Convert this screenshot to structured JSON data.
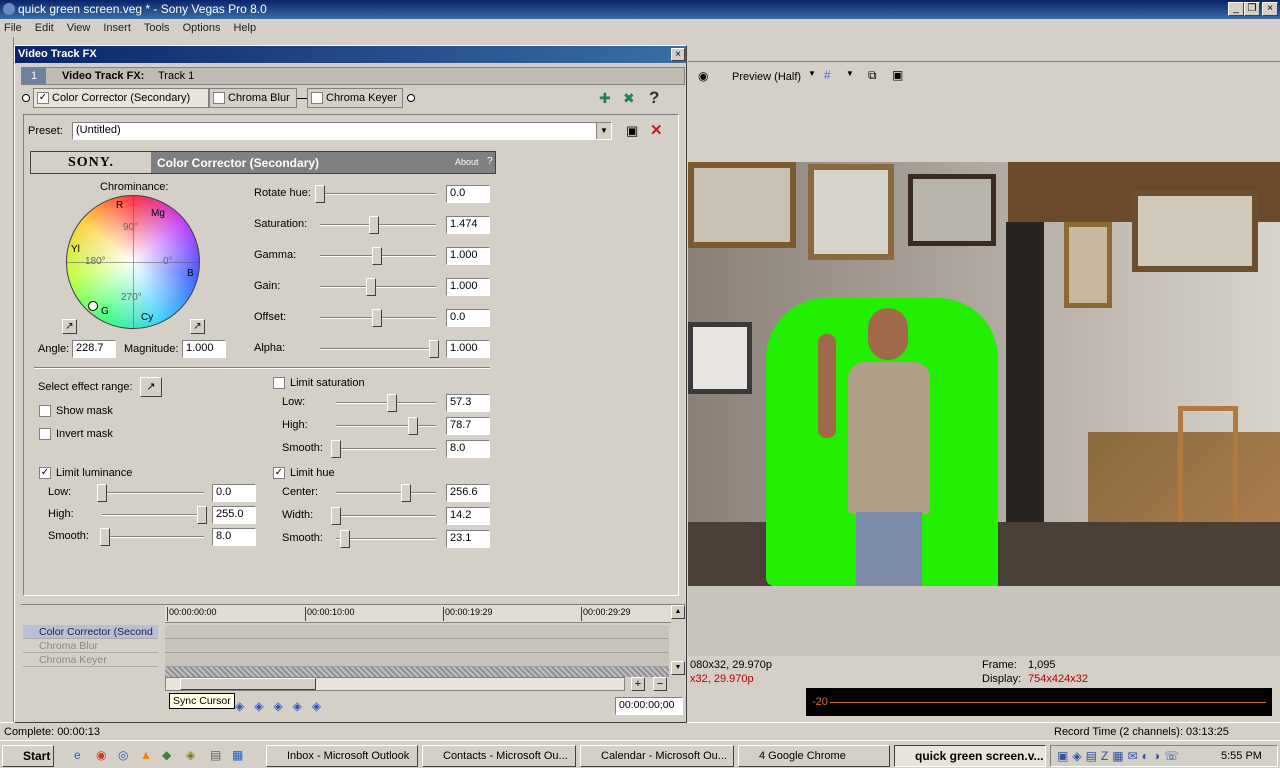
{
  "app": {
    "title": "quick green screen.veg * - Sony Vegas Pro 8.0",
    "menu": [
      "File",
      "Edit",
      "View",
      "Insert",
      "Tools",
      "Options",
      "Help"
    ]
  },
  "preview": {
    "mode": "Preview (Half)"
  },
  "info": {
    "project_line1": "080x32, 29.970p",
    "project_line2": "x32, 29.970p",
    "frame_label": "Frame:",
    "frame_value": "1,095",
    "display_label": "Display:",
    "display_value": "754x424x32",
    "meter_value": "-20"
  },
  "status": {
    "complete": "Complete: 00:00:13",
    "record_time": "Record Time (2 channels): 03:13:25"
  },
  "taskbar": {
    "start": "Start",
    "items": [
      "Inbox - Microsoft Outlook",
      "Contacts - Microsoft Ou...",
      "Calendar - Microsoft Ou...",
      "4 Google Chrome",
      "quick green screen.v..."
    ],
    "clock": "5:55 PM"
  },
  "dialog": {
    "title": "Video Track FX",
    "track_num": "1",
    "track_label": "Video Track FX:",
    "track_name": "Track 1",
    "fx_chain": [
      "Color Corrector (Secondary)",
      "Chroma Blur",
      "Chroma Keyer"
    ],
    "preset_label": "Preset:",
    "preset_value": "(Untitled)",
    "brand": "SONY.",
    "plugin_name": "Color Corrector (Secondary)",
    "about": "About",
    "help": "?",
    "chrominance_label": "Chrominance:",
    "wheel": {
      "r": "R",
      "mg": "Mg",
      "yl": "Yl",
      "b": "B",
      "g": "G",
      "cy": "Cy",
      "d90": "90°",
      "d180": "180°",
      "d0": "0°",
      "d270": "270°"
    },
    "angle_label": "Angle:",
    "angle_value": "228.7",
    "magnitude_label": "Magnitude:",
    "magnitude_value": "1.000",
    "sliders": [
      {
        "label": "Rotate hue:",
        "value": "0.0",
        "pos": 0.0
      },
      {
        "label": "Saturation:",
        "value": "1.474",
        "pos": 0.47
      },
      {
        "label": "Gamma:",
        "value": "1.000",
        "pos": 0.5
      },
      {
        "label": "Gain:",
        "value": "1.000",
        "pos": 0.45
      },
      {
        "label": "Offset:",
        "value": "0.0",
        "pos": 0.5
      },
      {
        "label": "Alpha:",
        "value": "1.000",
        "pos": 1.0
      }
    ],
    "select_range": "Select effect range:",
    "show_mask": "Show mask",
    "invert_mask": "Invert mask",
    "limit_luminance": "Limit luminance",
    "lum": [
      {
        "label": "Low:",
        "value": "0.0",
        "pos": 0.0
      },
      {
        "label": "High:",
        "value": "255.0",
        "pos": 1.0
      },
      {
        "label": "Smooth:",
        "value": "8.0",
        "pos": 0.03
      }
    ],
    "limit_saturation": "Limit saturation",
    "sat": [
      {
        "label": "Low:",
        "value": "57.3",
        "pos": 0.57
      },
      {
        "label": "High:",
        "value": "78.7",
        "pos": 0.79
      },
      {
        "label": "Smooth:",
        "value": "8.0",
        "pos": 0.0
      }
    ],
    "limit_hue": "Limit hue",
    "hue": [
      {
        "label": "Center:",
        "value": "256.6",
        "pos": 0.71
      },
      {
        "label": "Width:",
        "value": "14.2",
        "pos": 0.0
      },
      {
        "label": "Smooth:",
        "value": "23.1",
        "pos": 0.09
      }
    ],
    "timeline": {
      "marks": [
        "00:00:00:00",
        "00:00:10:00",
        "00:00:19:29",
        "00:00:29:29"
      ],
      "rows": [
        "Color Corrector (Second",
        "Chroma Blur",
        "Chroma Keyer"
      ],
      "tooltip": "Sync Cursor",
      "time": "00:00:00;00"
    }
  },
  "colors": {
    "accent": "#0a246a",
    "green": "#22ee00"
  }
}
